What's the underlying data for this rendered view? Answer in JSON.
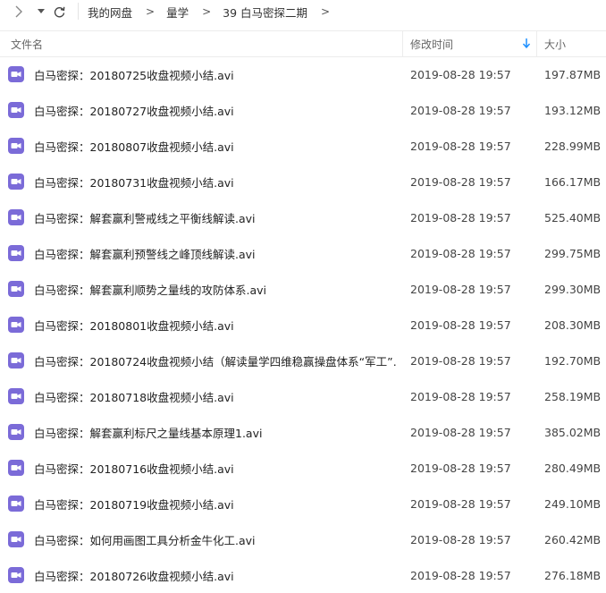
{
  "toolbar": {
    "forward_icon": "chevron-right-icon",
    "dropdown_icon": "caret-down-icon",
    "refresh_icon": "refresh-icon"
  },
  "breadcrumb": {
    "items": [
      "我的网盘",
      "量学",
      "39 白马密探二期"
    ],
    "separator": ">"
  },
  "columns": {
    "name": "文件名",
    "modified": "修改时间",
    "size": "大小",
    "sort_indicator": "arrow-down-icon",
    "sort_color": "#1e90ff"
  },
  "icon_color": "#7b6bd8",
  "files": [
    {
      "name": "白马密探：20180725收盘视频小结.avi",
      "modified": "2019-08-28 19:57",
      "size": "197.87MB"
    },
    {
      "name": "白马密探：20180727收盘视频小结.avi",
      "modified": "2019-08-28 19:57",
      "size": "193.12MB"
    },
    {
      "name": "白马密探：20180807收盘视频小结.avi",
      "modified": "2019-08-28 19:57",
      "size": "228.99MB"
    },
    {
      "name": "白马密探：20180731收盘视频小结.avi",
      "modified": "2019-08-28 19:57",
      "size": "166.17MB"
    },
    {
      "name": "白马密探：解套赢利警戒线之平衡线解读.avi",
      "modified": "2019-08-28 19:57",
      "size": "525.40MB"
    },
    {
      "name": "白马密探：解套赢利预警线之峰顶线解读.avi",
      "modified": "2019-08-28 19:57",
      "size": "299.75MB"
    },
    {
      "name": "白马密探：解套赢利顺势之量线的攻防体系.avi",
      "modified": "2019-08-28 19:57",
      "size": "299.30MB"
    },
    {
      "name": "白马密探：20180801收盘视频小结.avi",
      "modified": "2019-08-28 19:57",
      "size": "208.30MB"
    },
    {
      "name": "白马密探：20180724收盘视频小结（解读量学四维稳赢操盘体系“军工”…",
      "modified": "2019-08-28 19:57",
      "size": "192.70MB"
    },
    {
      "name": "白马密探：20180718收盘视频小结.avi",
      "modified": "2019-08-28 19:57",
      "size": "258.19MB"
    },
    {
      "name": "白马密探：解套赢利标尺之量线基本原理1.avi",
      "modified": "2019-08-28 19:57",
      "size": "385.02MB"
    },
    {
      "name": "白马密探：20180716收盘视频小结.avi",
      "modified": "2019-08-28 19:57",
      "size": "280.49MB"
    },
    {
      "name": "白马密探：20180719收盘视频小结.avi",
      "modified": "2019-08-28 19:57",
      "size": "249.10MB"
    },
    {
      "name": "白马密探：如何用画图工具分析金牛化工.avi",
      "modified": "2019-08-28 19:57",
      "size": "260.42MB"
    },
    {
      "name": "白马密探：20180726收盘视频小结.avi",
      "modified": "2019-08-28 19:57",
      "size": "276.18MB"
    }
  ]
}
